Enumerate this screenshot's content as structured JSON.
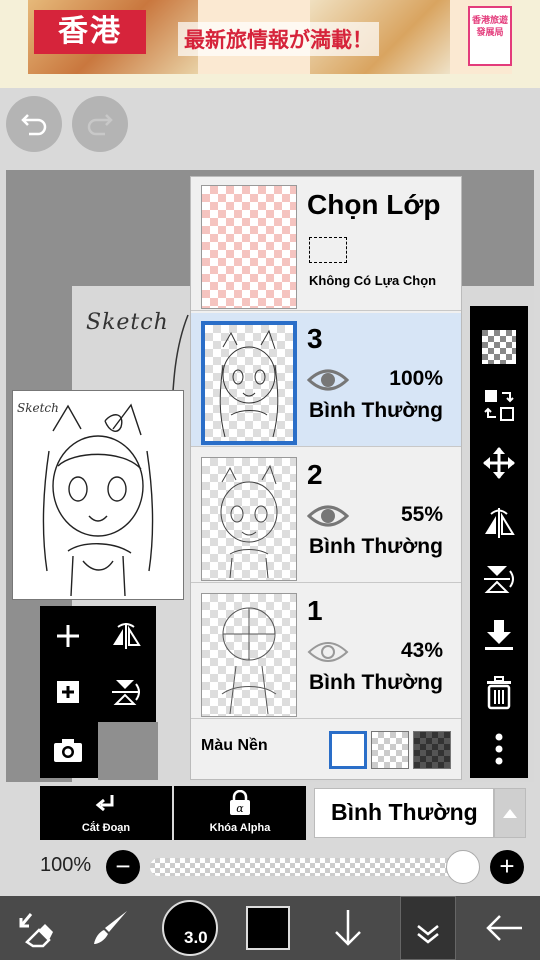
{
  "ad": {
    "red_label": "香港",
    "headline": "最新旅情報が満載！",
    "logo_text": "香港旅遊發展局"
  },
  "canvas": {
    "paper_word": "Sketch",
    "preview_word": "Sketch"
  },
  "layers_panel": {
    "selection": {
      "title": "Chọn Lớp",
      "status": "Không Có Lựa Chọn"
    },
    "layers": [
      {
        "number": "3",
        "opacity": "100%",
        "blend": "Bình Thường",
        "selected": true
      },
      {
        "number": "2",
        "opacity": "55%",
        "blend": "Bình Thường",
        "selected": false
      },
      {
        "number": "1",
        "opacity": "43%",
        "blend": "Bình Thường",
        "selected": false
      }
    ],
    "background": {
      "label": "Màu Nền",
      "options": [
        "white",
        "transparent",
        "dark-checker"
      ],
      "selected": "white"
    }
  },
  "actions": {
    "clip_label": "Cắt Đoạn",
    "alpha_lock_label": "Khóa Alpha",
    "blend_mode": "Bình Thường"
  },
  "opacity": {
    "label": "100%",
    "value": 100
  },
  "bottom_bar": {
    "brush_size": "3.0",
    "current_color": "#000000"
  },
  "colors": {
    "accent": "#2a6ec8",
    "panel_bg": "#f0f0f0",
    "selected_row": "#d7e5f6",
    "toolbar": "#000000"
  }
}
